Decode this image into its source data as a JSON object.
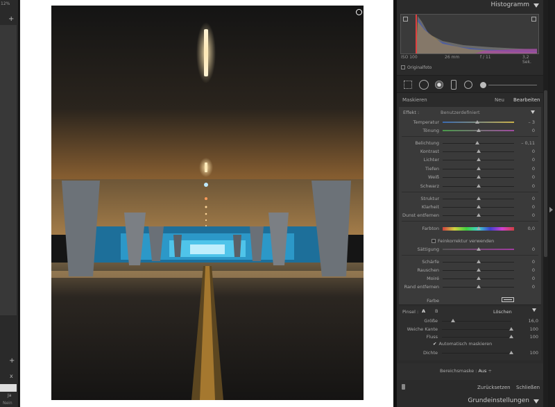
{
  "left_panel": {
    "zoom": "12%",
    "plus1": "+",
    "plus2": "+",
    "close": "x",
    "yes": "Ja",
    "no": "Nein"
  },
  "histogram": {
    "title": "Histogramm",
    "iso": "ISO 100",
    "focal": "26 mm",
    "aperture": "f / 11",
    "shutter": "3,2 Sek.",
    "original_photo": "Originalfoto"
  },
  "masking": {
    "label": "Maskieren",
    "new": "Neu",
    "edit": "Bearbeiten"
  },
  "effect": {
    "label": "Effekt :",
    "value": "Benutzerdefiniert"
  },
  "sliders": [
    {
      "label": "Temperatur",
      "value": "– 3",
      "pos": 0.49,
      "gradient": "linear-gradient(90deg,#3a6ab0,#c9b04a)"
    },
    {
      "label": "Tönung",
      "value": "0",
      "pos": 0.5,
      "gradient": "linear-gradient(90deg,#4a9a4a,#a04aa0)"
    },
    {
      "label": "Belichtung",
      "value": "– 0,11",
      "pos": 0.49,
      "gradient": ""
    },
    {
      "label": "Kontrast",
      "value": "0",
      "pos": 0.5,
      "gradient": ""
    },
    {
      "label": "Lichter",
      "value": "0",
      "pos": 0.5,
      "gradient": ""
    },
    {
      "label": "Tiefen",
      "value": "0",
      "pos": 0.5,
      "gradient": ""
    },
    {
      "label": "Weiß",
      "value": "0",
      "pos": 0.5,
      "gradient": ""
    },
    {
      "label": "Schwarz",
      "value": "0",
      "pos": 0.5,
      "gradient": ""
    },
    {
      "label": "Struktur",
      "value": "0",
      "pos": 0.5,
      "gradient": ""
    },
    {
      "label": "Klarheit",
      "value": "0",
      "pos": 0.5,
      "gradient": ""
    },
    {
      "label": "Dunst entfernen",
      "value": "0",
      "pos": 0.5,
      "gradient": ""
    },
    {
      "label": "Farbton",
      "value": "0,0",
      "pos": 0.5,
      "gradient": "linear-gradient(90deg,#d04040,#d0d040,#40d040,#40d0d0,#4040d0,#d040d0,#d04040)"
    },
    {
      "label": "Sättigung",
      "value": "0",
      "pos": 0.5,
      "gradient": "linear-gradient(90deg,#555,#a03ca0)"
    },
    {
      "label": "Schärfe",
      "value": "0",
      "pos": 0.5,
      "gradient": ""
    },
    {
      "label": "Rauschen",
      "value": "0",
      "pos": 0.5,
      "gradient": ""
    },
    {
      "label": "Moiré",
      "value": "0",
      "pos": 0.5,
      "gradient": ""
    },
    {
      "label": "Rand entfernen",
      "value": "0",
      "pos": 0.5,
      "gradient": ""
    }
  ],
  "fine_tune": "Feinkorrektur verwenden",
  "color_label": "Farbe",
  "brush": {
    "label": "Pinsel :",
    "a": "A",
    "b": "B",
    "erase": "Löschen",
    "size_label": "Größe",
    "size_value": "16,0",
    "size_pos": 0.16,
    "feather_label": "Weiche Kante",
    "feather_value": "100",
    "feather_pos": 1.0,
    "flow_label": "Fluss",
    "flow_value": "100",
    "flow_pos": 1.0,
    "auto_mask": "Automatisch maskieren",
    "density_label": "Dichte",
    "density_value": "100",
    "density_pos": 1.0
  },
  "range_mask": {
    "label": "Bereichsmaske :",
    "value": "Aus"
  },
  "actions": {
    "reset": "Zurücksetzen",
    "close": "Schließen"
  },
  "basic": {
    "title": "Grundeinstellungen"
  }
}
